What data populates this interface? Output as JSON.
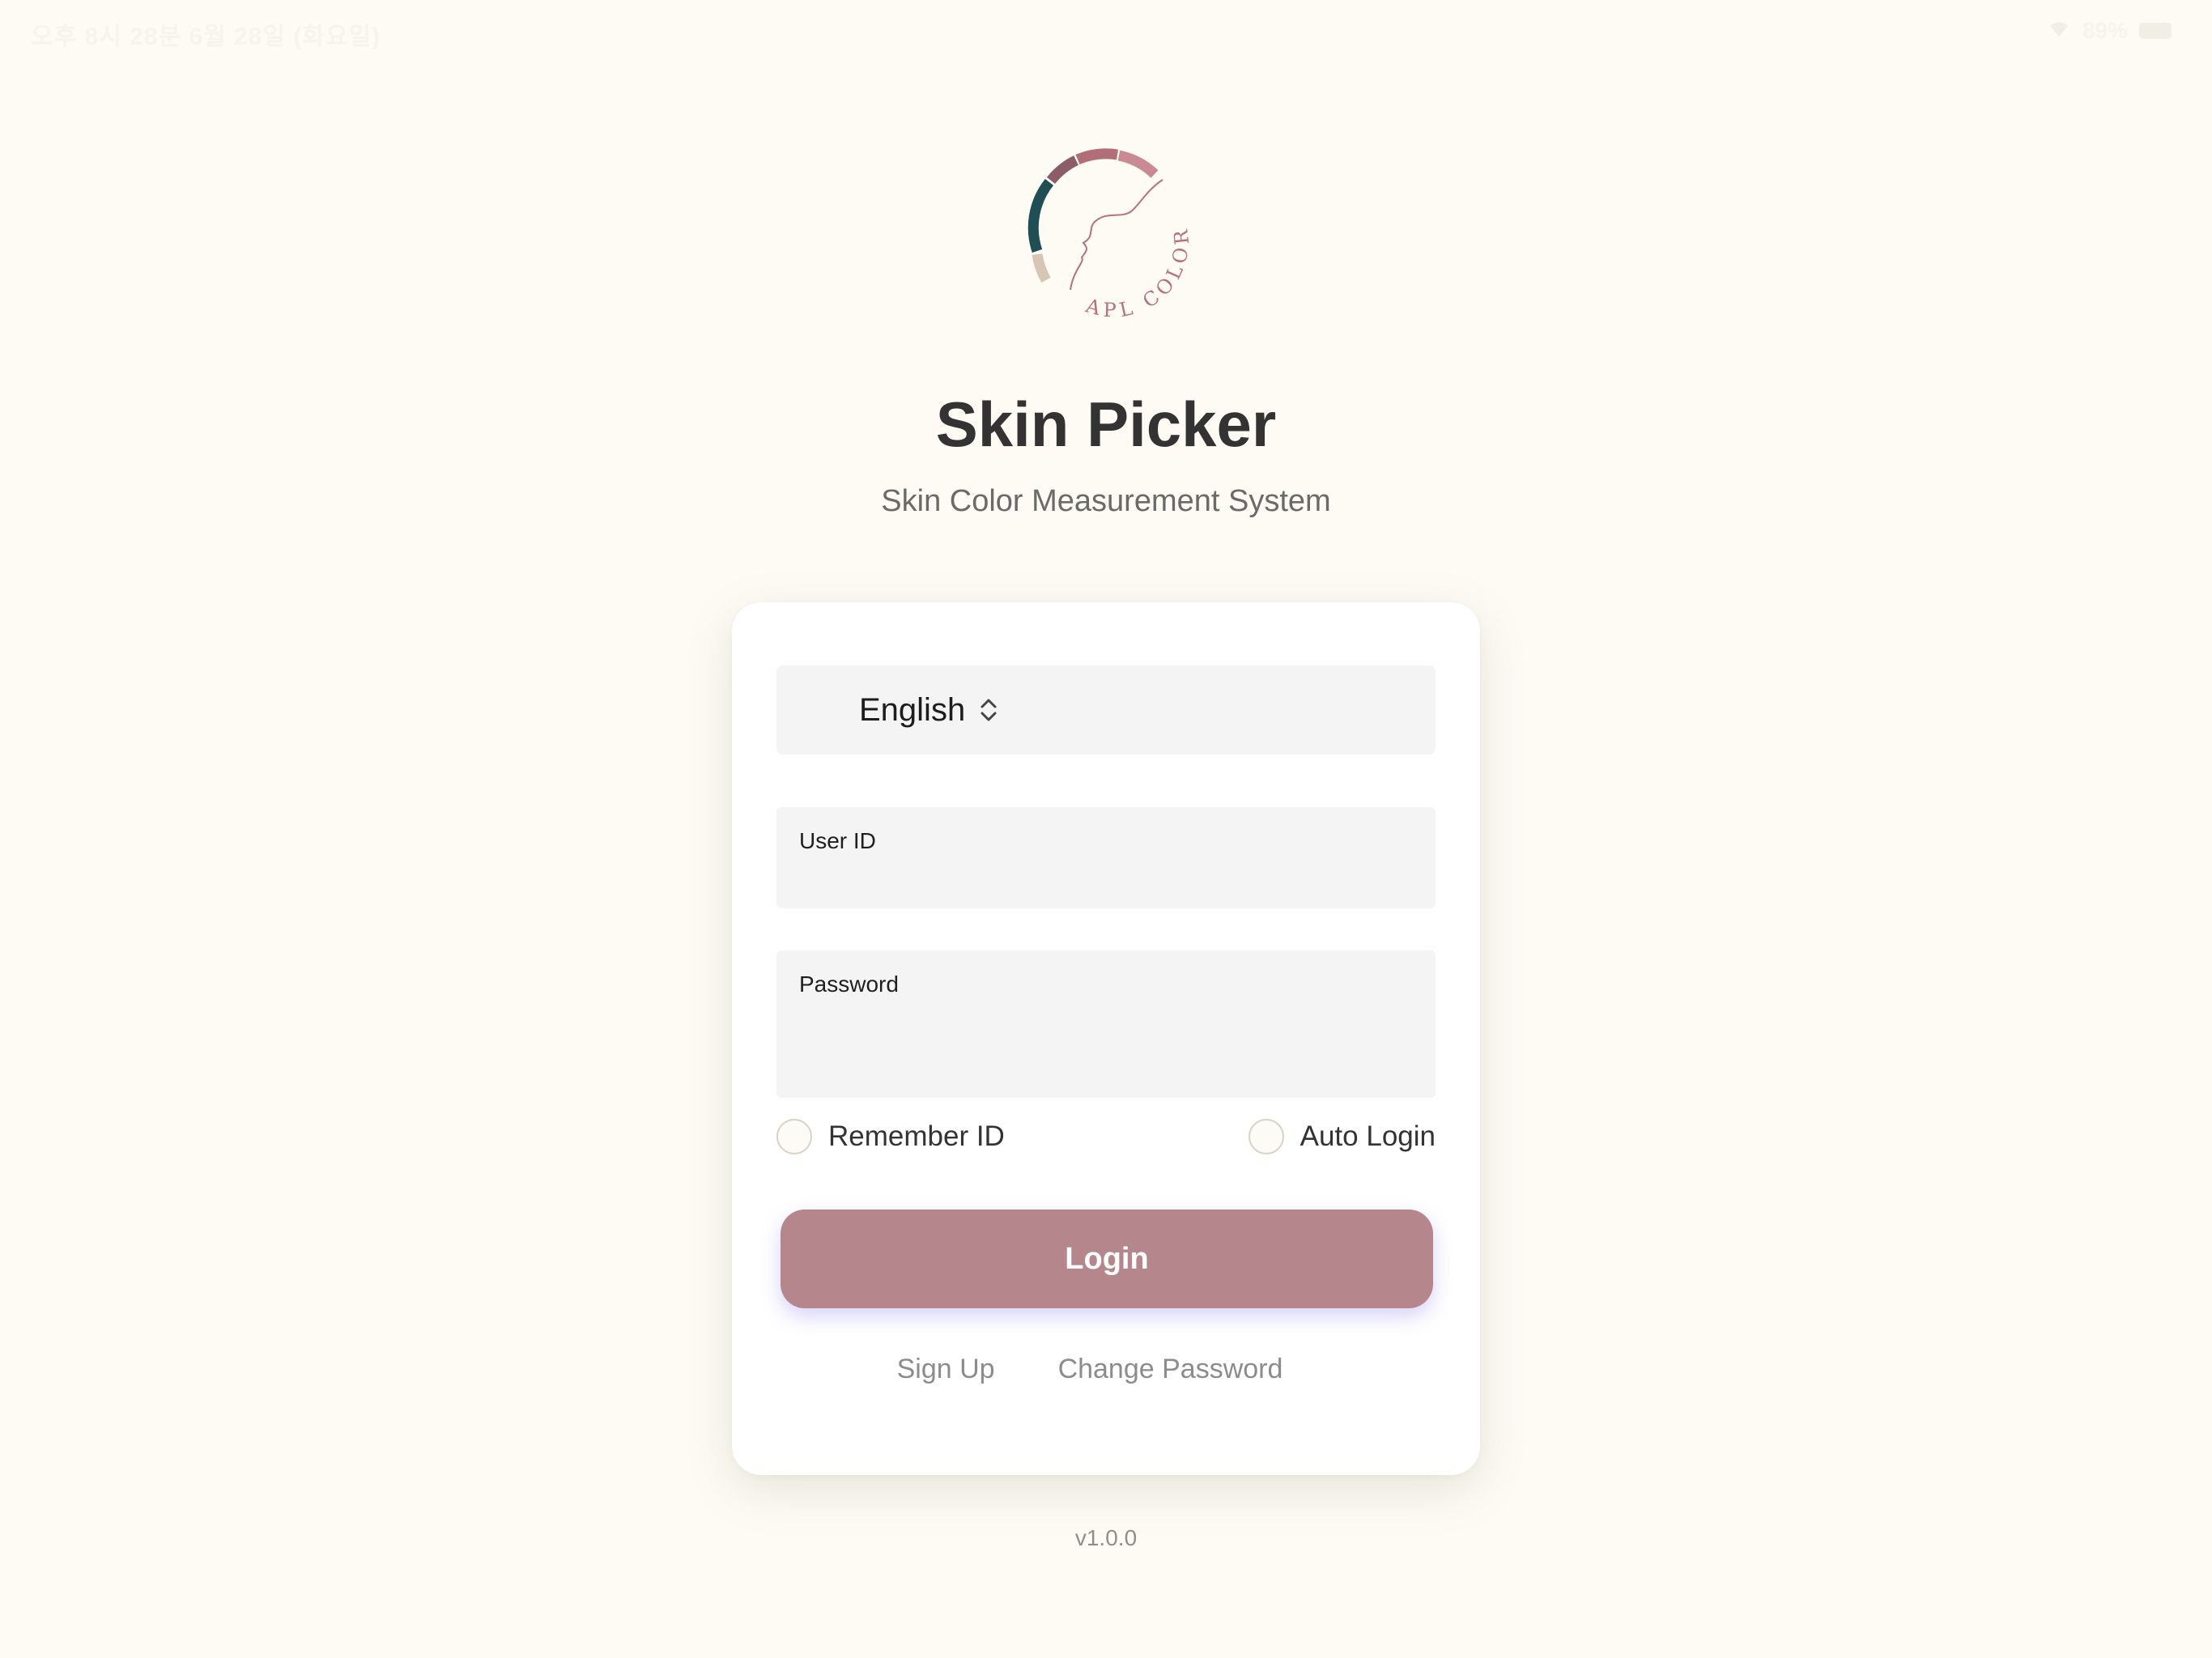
{
  "status_bar": {
    "left_text": "오후 8시 28분 6월 28일 (화요일)",
    "right_text": "89%"
  },
  "logo": {
    "text": "APL COLOR",
    "colors": {
      "teal": "#1f4f54",
      "mauve_dark": "#8c5d68",
      "rose": "#b26e78",
      "rose_light": "#c98a93",
      "beige": "#d8c6b4",
      "text": "#b8707a"
    }
  },
  "app": {
    "title": "Skin Picker",
    "subtitle": "Skin Color Measurement System"
  },
  "form": {
    "language": "English",
    "user_id_label": "User ID",
    "user_id_value": "",
    "password_label": "Password",
    "password_value": "",
    "remember_id_label": "Remember ID",
    "remember_id_checked": false,
    "auto_login_label": "Auto Login",
    "auto_login_checked": false,
    "login_label": "Login",
    "sign_up_label": "Sign Up",
    "change_password_label": "Change Password"
  },
  "footer": {
    "version": "v1.0.0"
  },
  "colors": {
    "background": "#fdfbf4",
    "button": "#b5878d",
    "field_bg": "#f4f4f4"
  }
}
